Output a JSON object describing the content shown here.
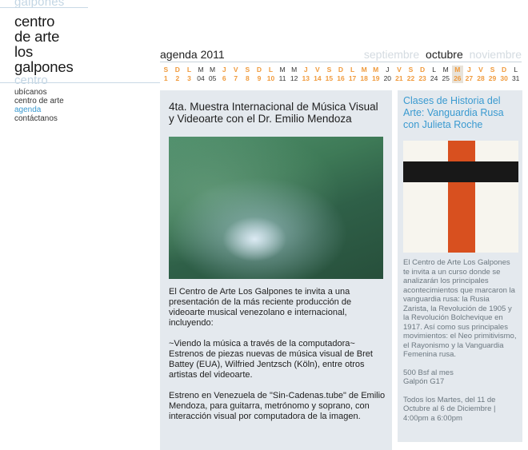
{
  "site": {
    "ghost_top": "galpones",
    "logo_lines": [
      "centro",
      "de arte",
      "los",
      "galpones"
    ],
    "ghost_bottom": "centro"
  },
  "nav": {
    "items": [
      {
        "label": "ubícanos",
        "active": false
      },
      {
        "label": "centro de arte",
        "active": false
      },
      {
        "label": "agenda",
        "active": true
      },
      {
        "label": "contáctanos",
        "active": false
      }
    ]
  },
  "agenda": {
    "title": "agenda 2011",
    "month_prev": "septiembre",
    "month_current": "octubre",
    "month_next": "noviembre"
  },
  "calendar": {
    "days": [
      {
        "letter": "S",
        "num": "1",
        "state": "event"
      },
      {
        "letter": "D",
        "num": "2",
        "state": "event"
      },
      {
        "letter": "L",
        "num": "3",
        "state": "event"
      },
      {
        "letter": "M",
        "num": "04",
        "state": "past"
      },
      {
        "letter": "M",
        "num": "05",
        "state": "past"
      },
      {
        "letter": "J",
        "num": "6",
        "state": "event"
      },
      {
        "letter": "V",
        "num": "7",
        "state": "event"
      },
      {
        "letter": "S",
        "num": "8",
        "state": "event"
      },
      {
        "letter": "D",
        "num": "9",
        "state": "event"
      },
      {
        "letter": "L",
        "num": "10",
        "state": "event"
      },
      {
        "letter": "M",
        "num": "11",
        "state": "past"
      },
      {
        "letter": "M",
        "num": "12",
        "state": "past"
      },
      {
        "letter": "J",
        "num": "13",
        "state": "event"
      },
      {
        "letter": "V",
        "num": "14",
        "state": "event"
      },
      {
        "letter": "S",
        "num": "15",
        "state": "event"
      },
      {
        "letter": "D",
        "num": "16",
        "state": "event"
      },
      {
        "letter": "L",
        "num": "17",
        "state": "event"
      },
      {
        "letter": "M",
        "num": "18",
        "state": "event"
      },
      {
        "letter": "M",
        "num": "19",
        "state": "event"
      },
      {
        "letter": "J",
        "num": "20",
        "state": "past"
      },
      {
        "letter": "V",
        "num": "21",
        "state": "event"
      },
      {
        "letter": "S",
        "num": "22",
        "state": "event"
      },
      {
        "letter": "D",
        "num": "23",
        "state": "event"
      },
      {
        "letter": "L",
        "num": "24",
        "state": "past"
      },
      {
        "letter": "M",
        "num": "25",
        "state": "past"
      },
      {
        "letter": "M",
        "num": "26",
        "state": "today"
      },
      {
        "letter": "J",
        "num": "27",
        "state": "event"
      },
      {
        "letter": "V",
        "num": "28",
        "state": "event"
      },
      {
        "letter": "S",
        "num": "29",
        "state": "event"
      },
      {
        "letter": "D",
        "num": "30",
        "state": "event"
      },
      {
        "letter": "L",
        "num": "31",
        "state": "past"
      }
    ]
  },
  "main_event": {
    "title": "4ta. Muestra Internacional de Música Visual y Videoarte con el Dr. Emilio Mendoza",
    "image_alt": "abstract green video still",
    "paragraphs": [
      "El Centro de Arte Los Galpones te invita a una presentación de la más reciente producción de videoarte musical venezolano e internacional, incluyendo:",
      "~Viendo la música a través de la computadora~ Estrenos de piezas nuevas de música visual de Bret Battey (EUA), Wilfried Jentzsch (Köln), entre otros artistas del videoarte.",
      "Estreno en Venezuela de \"Sin-Cadenas.tube\" de Emilio Mendoza, para guitarra, metrónomo y soprano, con interacción visual por computadora de la imagen."
    ]
  },
  "side_event": {
    "title": "Clases de Historia del Arte: Vanguardia Rusa con Julieta Roche",
    "image_alt": "suprematist cross painting",
    "paragraphs": [
      "El Centro de Arte Los Galpones te invita a un curso donde se analizarán los principales acontecimientos que marcaron la vanguardia rusa: la Rusia Zarista, la Revolución de 1905 y la Revolución Bolchevique en 1917. Así como sus principales movimientos: el Neo primitivismo, el Rayonismo y la Vanguardia Femenina rusa.",
      "500 Bsf al mes\nGalpón G17",
      "Todos los Martes, del 11 de Octubre al 6 de Diciembre | 4:00pm a 6:00pm"
    ]
  },
  "colors": {
    "accent_orange": "#f09a3c",
    "accent_blue": "#3a9ad0",
    "panel_bg": "#e4e9ee",
    "ghost_text": "#c3d6e4"
  }
}
